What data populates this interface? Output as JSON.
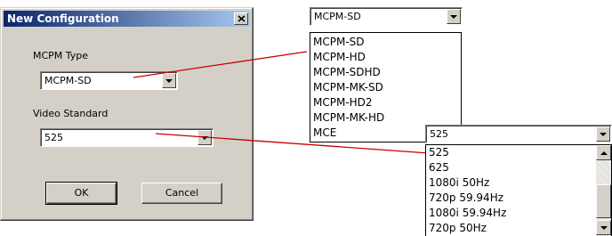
{
  "dialog": {
    "title": "New Configuration",
    "mcpm_type_label": "MCPM Type",
    "mcpm_type_value": "MCPM-SD",
    "video_standard_label": "Video Standard",
    "video_standard_value": "525",
    "ok_label": "OK",
    "cancel_label": "Cancel"
  },
  "mcpm_dropdown": {
    "selected": "MCPM-SD",
    "options": [
      "MCPM-SD",
      "MCPM-HD",
      "MCPM-SDHD",
      "MCPM-MK-SD",
      "MCPM-HD2",
      "MCPM-MK-HD",
      "MCE"
    ]
  },
  "video_dropdown": {
    "selected": "525",
    "options": [
      "525",
      "625",
      "1080i 50Hz",
      "720p 59.94Hz",
      "1080i 59.94Hz",
      "720p 50Hz"
    ]
  },
  "colors": {
    "annotation_line": "#cc0000",
    "title_gradient_start": "#0a246a",
    "title_gradient_end": "#a6caf0",
    "dialog_face": "#d4d0c8"
  }
}
